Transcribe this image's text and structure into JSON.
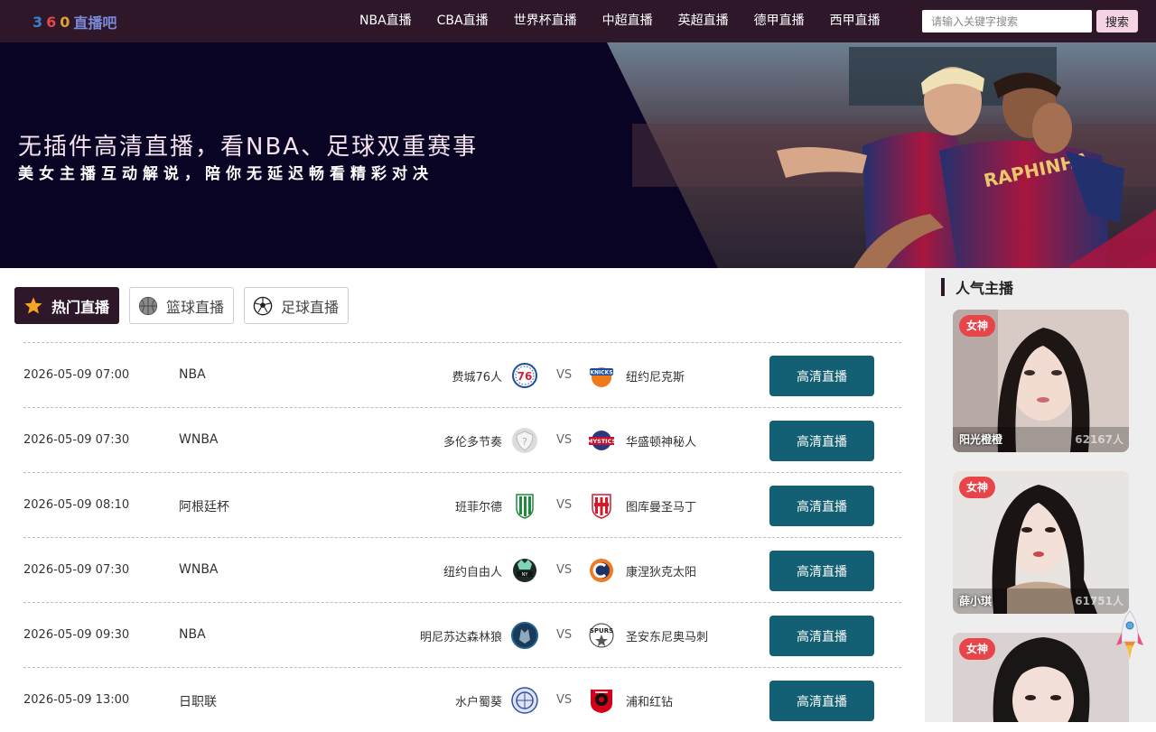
{
  "header": {
    "logo_text": "360直播吧",
    "nav": [
      "NBA直播",
      "CBA直播",
      "世界杯直播",
      "中超直播",
      "英超直播",
      "德甲直播",
      "西甲直播"
    ],
    "search_placeholder": "请输入关键字搜索",
    "search_button": "搜索"
  },
  "banner": {
    "title": "无插件高清直播，看NBA、足球双重赛事",
    "subtitle": "美女主播互动解说，陪你无延迟畅看精彩对决",
    "jersey_text": "RAPHINHA"
  },
  "tabs": [
    {
      "label": "热门直播",
      "icon": "star-icon",
      "active": true
    },
    {
      "label": "篮球直播",
      "icon": "basketball-icon",
      "active": false
    },
    {
      "label": "足球直播",
      "icon": "soccer-ball-icon",
      "active": false
    }
  ],
  "vs_text": "VS",
  "watch_label": "高清直播",
  "matches": [
    {
      "time": "2026-05-09 07:00",
      "league": "NBA",
      "home": "费城76人",
      "away": "纽约尼克斯",
      "home_logo": "76ers-logo",
      "away_logo": "knicks-logo"
    },
    {
      "time": "2026-05-09 07:30",
      "league": "WNBA",
      "home": "多伦多节奏",
      "away": "华盛顿神秘人",
      "home_logo": "placeholder-shield-logo",
      "away_logo": "mystics-logo"
    },
    {
      "time": "2026-05-09 08:10",
      "league": "阿根廷杯",
      "home": "班菲尔德",
      "away": "图库曼圣马丁",
      "home_logo": "banfield-logo",
      "away_logo": "san-martin-logo"
    },
    {
      "time": "2026-05-09 07:30",
      "league": "WNBA",
      "home": "纽约自由人",
      "away": "康涅狄克太阳",
      "home_logo": "liberty-logo",
      "away_logo": "sun-logo"
    },
    {
      "time": "2026-05-09 09:30",
      "league": "NBA",
      "home": "明尼苏达森林狼",
      "away": "圣安东尼奥马刺",
      "home_logo": "timberwolves-logo",
      "away_logo": "spurs-logo"
    },
    {
      "time": "2026-05-09 13:00",
      "league": "日职联",
      "home": "水户蜀葵",
      "away": "浦和红钻",
      "home_logo": "mito-logo",
      "away_logo": "urawa-logo"
    }
  ],
  "sidebar": {
    "title": "人气主播",
    "anchors": [
      {
        "badge": "女神",
        "name": "阳光橙橙",
        "viewers": "62167人"
      },
      {
        "badge": "女神",
        "name": "薛小琪",
        "viewers": "61751人"
      },
      {
        "badge": "女神",
        "name": "",
        "viewers": ""
      }
    ]
  },
  "colors": {
    "header_bg": "#2e1728",
    "button_bg": "#135f73",
    "badge_bg": "#e8454a",
    "banner_bg": "#0a0424"
  }
}
